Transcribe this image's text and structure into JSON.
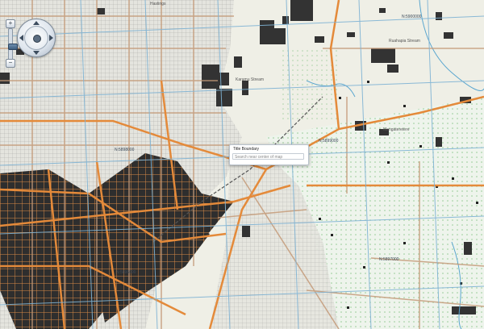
{
  "popup": {
    "title": "Title Boundary",
    "placeholder": "Search near center of map"
  },
  "grid_labels": [
    {
      "text": "N:5900000"
    },
    {
      "text": "N:5899000"
    },
    {
      "text": "N:5898000"
    },
    {
      "text": "N:5897000"
    },
    {
      "text": "N:5896000"
    }
  ],
  "places": [
    {
      "text": "Hastings"
    },
    {
      "text": "Ruahapia Stream"
    },
    {
      "text": "Karamu Stream"
    },
    {
      "text": "Mangateretere"
    }
  ],
  "navigation": {
    "zoom_in": "+",
    "zoom_out": "−"
  },
  "colors": {
    "land": "#efefe6",
    "rural": "#eef4ec",
    "road_major": "#e48a3a",
    "road_minor": "#c49a78",
    "grid": "#7fb3d4",
    "building": "#333333",
    "water": "#5aa6cf"
  }
}
